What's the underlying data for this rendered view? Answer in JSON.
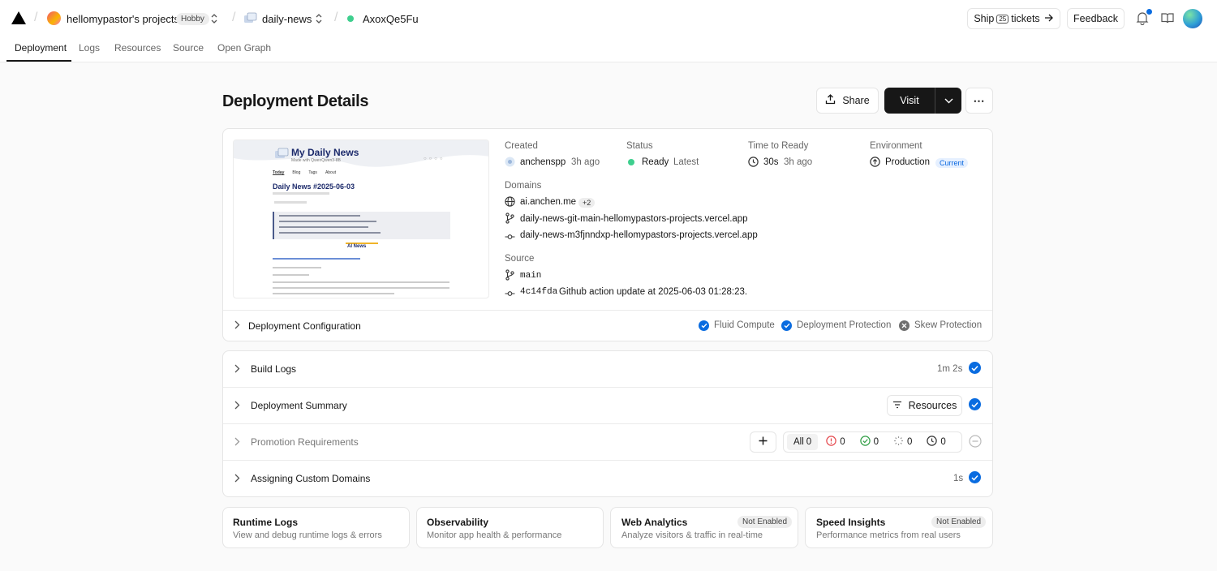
{
  "header": {
    "team_name": "hellomypastor's projects",
    "plan": "Hobby",
    "project": "daily-news",
    "deployment_id": "AxoxQe5Fu",
    "ship_label_a": "Ship",
    "ship_number": "25",
    "ship_label_b": "tickets",
    "feedback": "Feedback"
  },
  "tabs": [
    "Deployment",
    "Logs",
    "Resources",
    "Source",
    "Open Graph"
  ],
  "page": {
    "title": "Deployment Details",
    "share": "Share",
    "visit": "Visit"
  },
  "preview": {
    "site_title": "My Daily News",
    "site_subtitle": "Made with QwenQwen3-8B",
    "nav": [
      "Today",
      "Blog",
      "Tags",
      "About"
    ],
    "headline": "Daily News #2025-06-03",
    "section": "AI News"
  },
  "details": {
    "created_label": "Created",
    "created_user": "anchenspp",
    "created_time": "3h ago",
    "status_label": "Status",
    "status_value": "Ready",
    "status_tag": "Latest",
    "ttr_label": "Time to Ready",
    "ttr_value": "30s",
    "ttr_time": "3h ago",
    "env_label": "Environment",
    "env_value": "Production",
    "env_badge": "Current",
    "domains_label": "Domains",
    "domains": [
      "ai.anchen.me",
      "daily-news-git-main-hellomypastors-projects.vercel.app",
      "daily-news-m3fjnndxp-hellomypastors-projects.vercel.app"
    ],
    "domains_more": "+2",
    "source_label": "Source",
    "branch": "main",
    "commit_hash": "4c14fda",
    "commit_msg": "Github action update at 2025-06-03 01:28:23."
  },
  "config": {
    "title": "Deployment Configuration",
    "features": [
      "Fluid Compute",
      "Deployment Protection",
      "Skew Protection"
    ]
  },
  "sections": {
    "build_logs": "Build Logs",
    "build_time": "1m 2s",
    "summary": "Deployment Summary",
    "resources_btn": "Resources",
    "promotion": "Promotion Requirements",
    "all_label": "All",
    "all_count": "0",
    "error_count": "0",
    "ok_count": "0",
    "pending_count": "0",
    "waiting_count": "0",
    "domains_assign": "Assigning Custom Domains",
    "domains_time": "1s"
  },
  "bottom_cards": [
    {
      "title": "Runtime Logs",
      "desc": "View and debug runtime logs & errors",
      "badge": ""
    },
    {
      "title": "Observability",
      "desc": "Monitor app health & performance",
      "badge": ""
    },
    {
      "title": "Web Analytics",
      "desc": "Analyze visitors & traffic in real-time",
      "badge": "Not Enabled"
    },
    {
      "title": "Speed Insights",
      "desc": "Performance metrics from real users",
      "badge": "Not Enabled"
    }
  ],
  "colors": {
    "accent_blue": "#0a6ce0",
    "ready_green": "#3ecf8e",
    "visit_bg": "#171717"
  }
}
